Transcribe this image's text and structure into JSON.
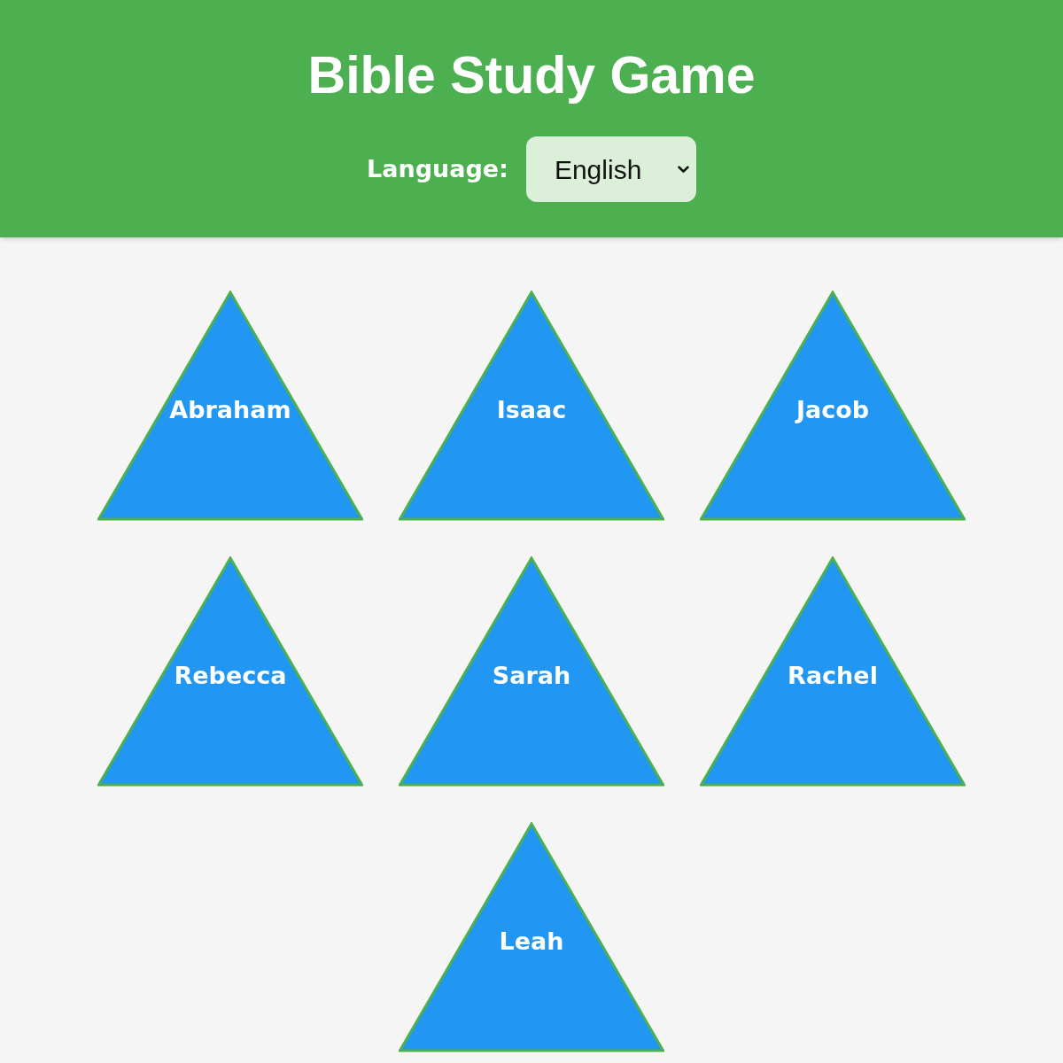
{
  "header": {
    "title": "Bible Study Game",
    "language": {
      "label": "Language:",
      "value": "English"
    }
  },
  "cards": [
    {
      "name": "Abraham"
    },
    {
      "name": "Isaac"
    },
    {
      "name": "Jacob"
    },
    {
      "name": "Rebecca"
    },
    {
      "name": "Sarah"
    },
    {
      "name": "Rachel"
    },
    {
      "name": "Leah"
    }
  ]
}
